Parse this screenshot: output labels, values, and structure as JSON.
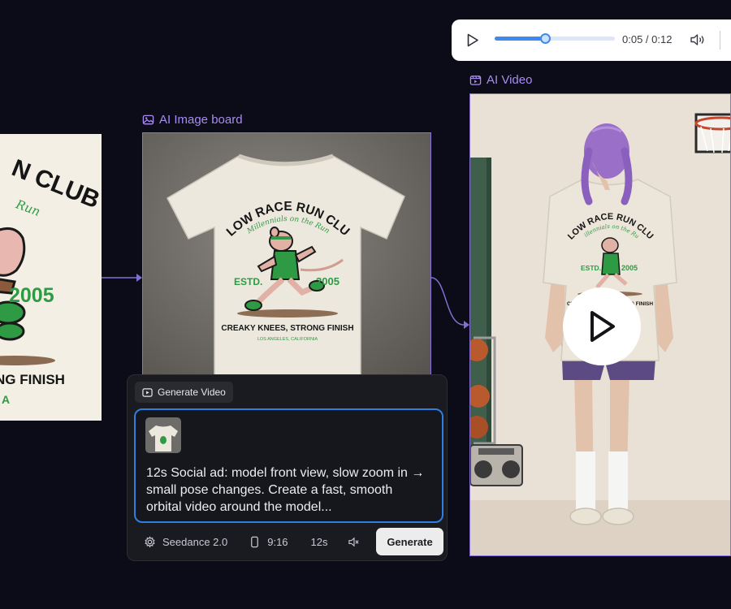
{
  "design_card": {
    "lines": [
      "N CLUB",
      "Run",
      "2005",
      "NG FINISH",
      "A"
    ]
  },
  "image_board": {
    "label": "AI Image board",
    "shirt": {
      "headline": "SLOW RACE RUN CLUB",
      "subline": "Millennials on the Run",
      "estd": "ESTD.",
      "year": "2005",
      "slogan": "CREAKY KNEES, STRONG FINISH",
      "location": "LOS ANGELES, CALIFORNIA"
    }
  },
  "generate_panel": {
    "chip_label": "Generate Video",
    "prompt": "12s Social ad: model front view, slow zoom in → small pose changes. Create a fast, smooth orbital video around the model...",
    "model": "Seedance 2.0",
    "aspect_ratio": "9:16",
    "duration": "12s",
    "generate_label": "Generate"
  },
  "player": {
    "time": "0:05 / 0:12",
    "progress": 0.42
  },
  "ai_video": {
    "label": "AI Video",
    "shirt": {
      "headline": "SLOW RACE RUN CLUB",
      "subline": "Millennials on the Run",
      "estd": "ESTD.",
      "year": "2005",
      "slogan": "CREAKY KNEES, STRONG FINISH"
    }
  },
  "colors": {
    "background": "#0b0c17",
    "accent": "#a98bf2",
    "focus": "#2f7fe0",
    "progress": "#3d8bef",
    "print_green": "#2e9a43"
  },
  "icons": [
    "image-icon",
    "video-icon",
    "play-icon",
    "volume-icon",
    "settings-icon",
    "phone-icon",
    "mute-icon"
  ]
}
